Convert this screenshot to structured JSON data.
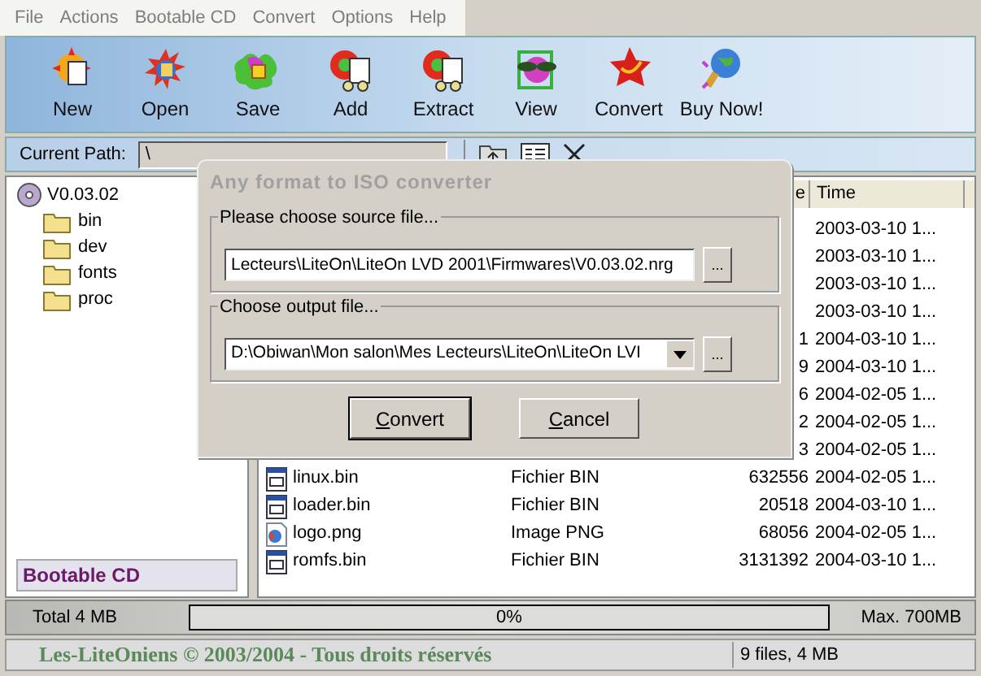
{
  "menu": [
    "File",
    "Actions",
    "Bootable CD",
    "Convert",
    "Options",
    "Help"
  ],
  "toolbar": [
    "New",
    "Open",
    "Save",
    "Add",
    "Extract",
    "View",
    "Convert",
    "Buy Now!"
  ],
  "path": {
    "label": "Current Path:",
    "value": "\\"
  },
  "tree": {
    "label": "V0.03.02",
    "children": [
      {
        "label": "bin"
      },
      {
        "label": "dev"
      },
      {
        "label": "fonts"
      },
      {
        "label": "proc"
      }
    ]
  },
  "sidebar_footer": "Bootable CD",
  "file_list": {
    "columns": [
      "e",
      "Time"
    ],
    "rows": [
      {
        "time": "2003-03-10 1..."
      },
      {
        "time": "2003-03-10 1..."
      },
      {
        "time": "2003-03-10 1..."
      },
      {
        "time": "2003-03-10 1..."
      },
      {
        "size": "1",
        "time": "2004-03-10 1..."
      },
      {
        "size": "9",
        "time": "2004-03-10 1..."
      },
      {
        "size": "6",
        "time": "2004-02-05 1..."
      },
      {
        "size": "2",
        "time": "2004-02-05 1..."
      },
      {
        "size": "3",
        "time": "2004-02-05 1..."
      },
      {
        "kind": "bin",
        "name": "linux.bin",
        "type": "Fichier BIN",
        "size": "632556",
        "time": "2004-02-05 1..."
      },
      {
        "kind": "bin",
        "name": "loader.bin",
        "type": "Fichier BIN",
        "size": "20518",
        "time": "2004-03-10 1..."
      },
      {
        "kind": "image",
        "name": "logo.png",
        "type": "Image PNG",
        "size": "68056",
        "time": "2004-02-05 1..."
      },
      {
        "kind": "bin",
        "name": "romfs.bin",
        "type": "Fichier BIN",
        "size": "3131392",
        "time": "2004-03-10 1..."
      }
    ]
  },
  "dialog": {
    "title": "Any format to ISO converter",
    "source": {
      "label": "Please choose source file...",
      "value": "Lecteurs\\LiteOn\\LiteOn LVD 2001\\Firmwares\\V0.03.02.nrg",
      "browse": "..."
    },
    "output": {
      "label": "Choose output file...",
      "value": "D:\\Obiwan\\Mon salon\\Mes Lecteurs\\LiteOn\\LiteOn LVI",
      "browse": "..."
    },
    "buttons": [
      {
        "label": "Convert",
        "default": true
      },
      {
        "label": "Cancel",
        "default": false
      }
    ]
  },
  "status": {
    "total": "Total 4 MB",
    "level": 0,
    "reading": "0%",
    "max": "Max. 700MB"
  },
  "footer": {
    "copyright": "Les-LiteOniens © 2003/2004 - Tous droits réservés",
    "summary": "9 files, 4 MB"
  }
}
